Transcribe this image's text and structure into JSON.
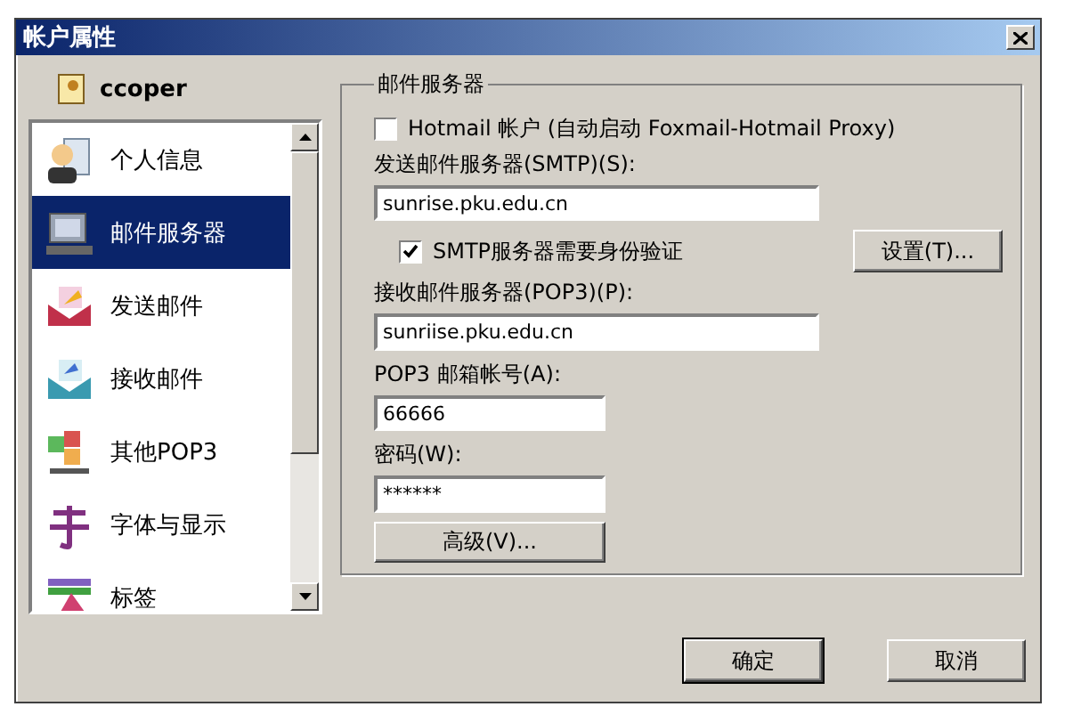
{
  "window": {
    "title": "帐户属性"
  },
  "account": {
    "name": "ccoper"
  },
  "sidebar": {
    "items": [
      {
        "label": "个人信息",
        "selected": false
      },
      {
        "label": "邮件服务器",
        "selected": true
      },
      {
        "label": "发送邮件",
        "selected": false
      },
      {
        "label": "接收邮件",
        "selected": false
      },
      {
        "label": "其他POP3",
        "selected": false
      },
      {
        "label": "字体与显示",
        "selected": false
      },
      {
        "label": "标签",
        "selected": false
      }
    ]
  },
  "group": {
    "title": "邮件服务器",
    "hotmail": {
      "label": "Hotmail 帐户 (自动启动 Foxmail-Hotmail Proxy)",
      "checked": false
    },
    "smtp_label": "发送邮件服务器(SMTP)(S):",
    "smtp_value": "sunrise.pku.edu.cn",
    "auth": {
      "label": "SMTP服务器需要身份验证",
      "checked": true
    },
    "settings_button": "设置(T)...",
    "pop3_label": "接收邮件服务器(POP3)(P):",
    "pop3_value": "sunriise.pku.edu.cn",
    "account_label": "POP3 邮箱帐号(A):",
    "account_value": "66666",
    "password_label": "密码(W):",
    "password_value": "******",
    "advanced_button": "高级(V)..."
  },
  "buttons": [
    "确定",
    "取消"
  ]
}
